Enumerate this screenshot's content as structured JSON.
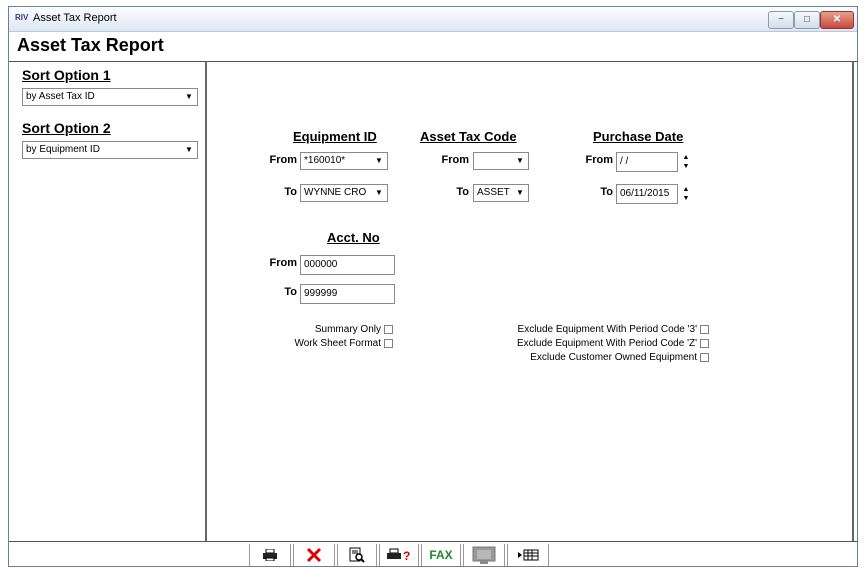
{
  "window": {
    "app_icon": "RIV",
    "title": "Asset Tax Report",
    "controls": {
      "minimize": "−",
      "maximize": "□",
      "close": "✕"
    }
  },
  "report_title": "Asset Tax Report",
  "sidebar": {
    "sort1_label": "Sort Option 1",
    "sort1_value": "by Asset Tax ID",
    "sort2_label": "Sort Option 2",
    "sort2_value": "by Equipment ID"
  },
  "equipment": {
    "header": "Equipment ID",
    "from_label": "From",
    "from_value": "*160010*",
    "to_label": "To",
    "to_value": "WYNNE CRO"
  },
  "asset_tax_code": {
    "header": "Asset Tax Code",
    "from_label": "From",
    "from_value": "",
    "to_label": "To",
    "to_value": "ASSET"
  },
  "purchase_date": {
    "header": "Purchase Date",
    "from_label": "From",
    "from_value": " / /",
    "to_label": "To",
    "to_value": "06/11/2015"
  },
  "acct": {
    "header": "Acct. No",
    "from_label": "From",
    "from_value": "000000",
    "to_label": "To",
    "to_value": "999999"
  },
  "options": {
    "summary_only": "Summary Only",
    "work_sheet": "Work Sheet Format",
    "excl_period_3": "Exclude Equipment With Period Code '3'",
    "excl_period_z": "Exclude Equipment With Period Code 'Z'",
    "excl_customer": "Exclude Customer Owned Equipment"
  },
  "toolbar": {
    "fax_label": "FAX",
    "icons": [
      "print-icon",
      "cancel-icon",
      "preview-icon",
      "print-setup-icon",
      "fax-icon",
      "monitor-icon",
      "export-grid-icon"
    ]
  },
  "colors": {
    "cancel": "#e00000",
    "fax": "#1e8a2a",
    "titlebar_close": "#c6483a"
  }
}
